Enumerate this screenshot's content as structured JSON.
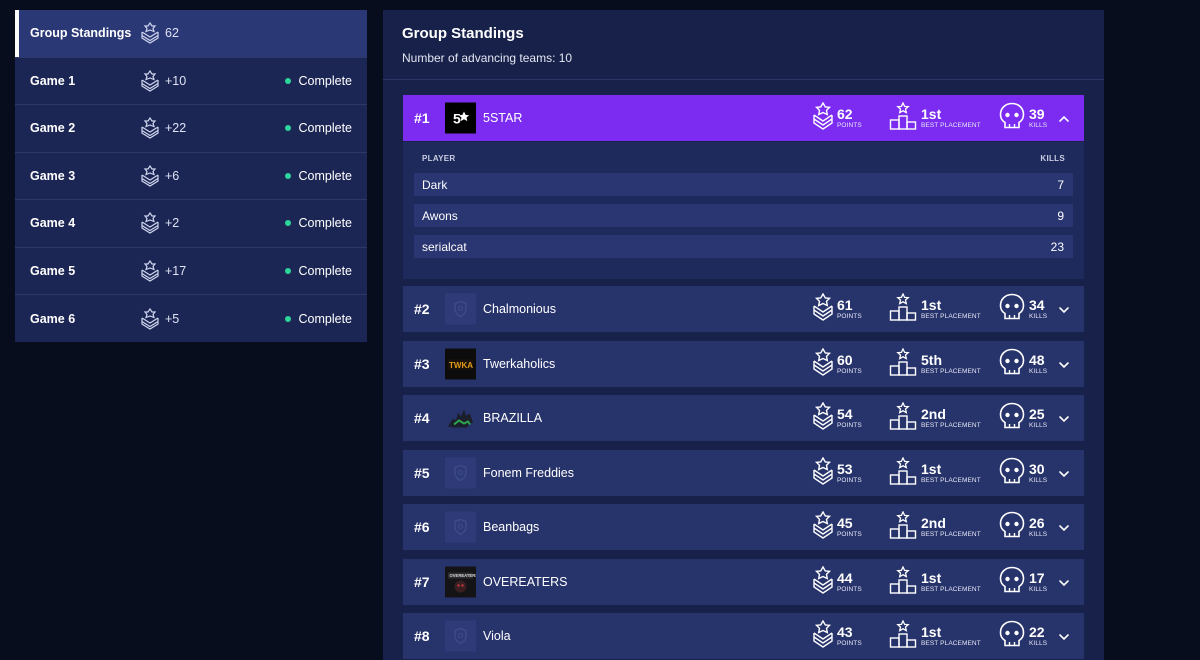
{
  "sidebar": {
    "items": [
      {
        "name": "Group Standings",
        "points": "62",
        "status": ""
      },
      {
        "name": "Game 1",
        "points": "+10",
        "status": "Complete"
      },
      {
        "name": "Game 2",
        "points": "+22",
        "status": "Complete"
      },
      {
        "name": "Game 3",
        "points": "+6",
        "status": "Complete"
      },
      {
        "name": "Game 4",
        "points": "+2",
        "status": "Complete"
      },
      {
        "name": "Game 5",
        "points": "+17",
        "status": "Complete"
      },
      {
        "name": "Game 6",
        "points": "+5",
        "status": "Complete"
      }
    ]
  },
  "main": {
    "title": "Group Standings",
    "subtitle": "Number of advancing teams: 10"
  },
  "labels": {
    "points": "POINTS",
    "best_placement": "BEST PLACEMENT",
    "kills": "KILLS",
    "player_header": "PLAYER",
    "kills_header": "KILLS"
  },
  "teams": [
    {
      "rank": "#1",
      "name": "5STAR",
      "points": "62",
      "placement": "1st",
      "kills": "39",
      "logo": "5star-logo"
    },
    {
      "rank": "#2",
      "name": "Chalmonious",
      "points": "61",
      "placement": "1st",
      "kills": "34",
      "logo": "default-shield-logo"
    },
    {
      "rank": "#3",
      "name": "Twerkaholics",
      "points": "60",
      "placement": "5th",
      "kills": "48",
      "logo": "twerkaholics-logo"
    },
    {
      "rank": "#4",
      "name": "BRAZILLA",
      "points": "54",
      "placement": "2nd",
      "kills": "25",
      "logo": "brazilla-logo"
    },
    {
      "rank": "#5",
      "name": "Fonem Freddies",
      "points": "53",
      "placement": "1st",
      "kills": "30",
      "logo": "default-shield-logo"
    },
    {
      "rank": "#6",
      "name": "Beanbags",
      "points": "45",
      "placement": "2nd",
      "kills": "26",
      "logo": "default-shield-logo"
    },
    {
      "rank": "#7",
      "name": "OVEREATERS",
      "points": "44",
      "placement": "1st",
      "kills": "17",
      "logo": "overeaters-logo"
    },
    {
      "rank": "#8",
      "name": "Viola",
      "points": "43",
      "placement": "1st",
      "kills": "22",
      "logo": "default-shield-logo"
    }
  ],
  "expanded_players": [
    {
      "name": "Dark",
      "kills": "7"
    },
    {
      "name": "Awons",
      "kills": "9"
    },
    {
      "name": "serialcat",
      "kills": "23"
    }
  ],
  "colors": {
    "accent": "#7b2cf0",
    "status_dot": "#2ed59a",
    "row_bg": "#27336b",
    "panel_bg": "#18214a"
  }
}
